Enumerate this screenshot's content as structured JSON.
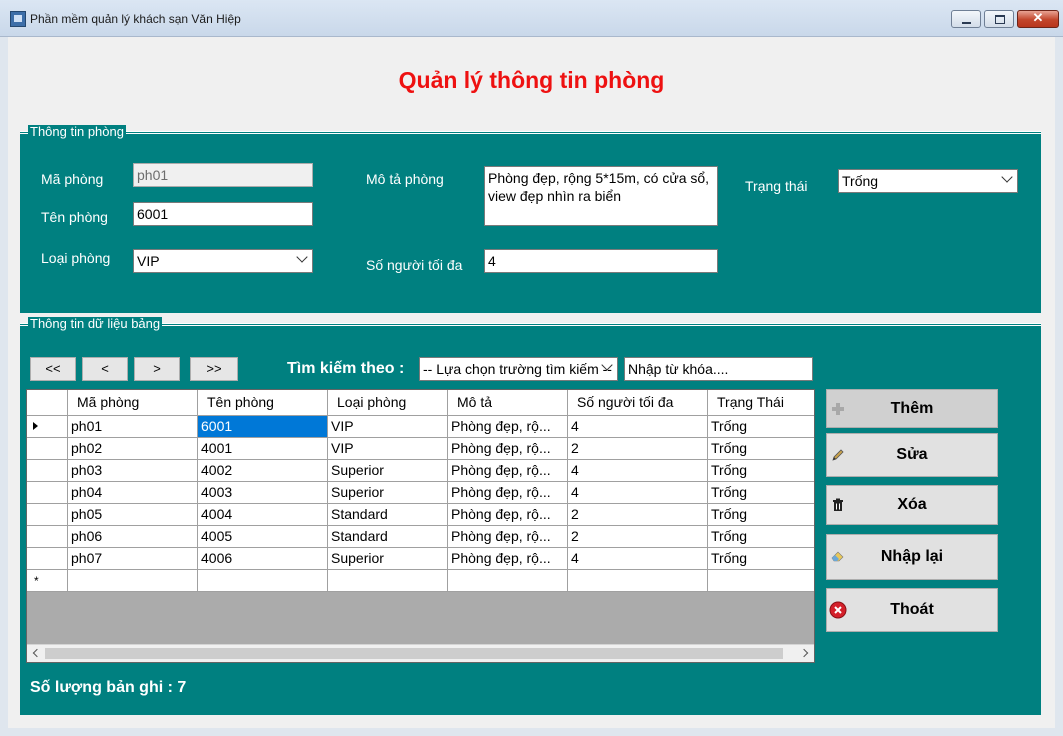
{
  "window": {
    "title": "Phần mềm quản lý khách sạn Văn Hiệp"
  },
  "heading": "Quản lý thông tin phòng",
  "room_info": {
    "legend": "Thông tin phòng",
    "ma_phong_label": "Mã phòng",
    "ma_phong_value": "ph01",
    "ten_phong_label": "Tên phòng",
    "ten_phong_value": "6001",
    "loai_phong_label": "Loại phòng",
    "loai_phong_value": "VIP",
    "mo_ta_label": "Mô tả phòng",
    "mo_ta_value": "Phòng đẹp, rộng 5*15m, có cửa sổ, view đẹp nhìn ra biển",
    "so_nguoi_label": "Số người tối đa",
    "so_nguoi_value": "4",
    "trang_thai_label": "Trạng thái",
    "trang_thai_value": "Trống"
  },
  "table_section": {
    "legend": "Thông tin dữ liệu  bảng",
    "nav": {
      "first": "<<",
      "prev": "<",
      "next": ">",
      "last": ">>"
    },
    "search_label": "Tìm kiếm theo :",
    "search_field_value": "-- Lựa chọn trường tìm kiếm --",
    "keyword_value": "Nhập từ khóa....",
    "columns": [
      "Mã phòng",
      "Tên phòng",
      "Loại phòng",
      "Mô tả",
      "Số người tối đa",
      "Trạng Thái"
    ],
    "rows": [
      [
        "ph01",
        "6001",
        "VIP",
        "Phòng đẹp, rộ...",
        "4",
        "Trống"
      ],
      [
        "ph02",
        "4001",
        "VIP",
        "Phòng đẹp, rộ...",
        "2",
        "Trống"
      ],
      [
        "ph03",
        "4002",
        "Superior",
        "Phòng đẹp, rộ...",
        "4",
        "Trống"
      ],
      [
        "ph04",
        "4003",
        "Superior",
        "Phòng đẹp, rộ...",
        "4",
        "Trống"
      ],
      [
        "ph05",
        "4004",
        "Standard",
        "Phòng đẹp, rộ...",
        "2",
        "Trống"
      ],
      [
        "ph06",
        "4005",
        "Standard",
        "Phòng đẹp, rộ...",
        "2",
        "Trống"
      ],
      [
        "ph07",
        "4006",
        "Superior",
        "Phòng đẹp, rộ...",
        "4",
        "Trống"
      ]
    ],
    "new_row_marker": "*",
    "record_count_label": "Số lượng bản ghi : 7"
  },
  "actions": {
    "add": "Thêm",
    "edit": "Sửa",
    "delete": "Xóa",
    "reset": "Nhập lại",
    "exit": "Thoát"
  },
  "colors": {
    "panel": "#008080",
    "heading": "#ee1111",
    "selection": "#0078d7"
  }
}
